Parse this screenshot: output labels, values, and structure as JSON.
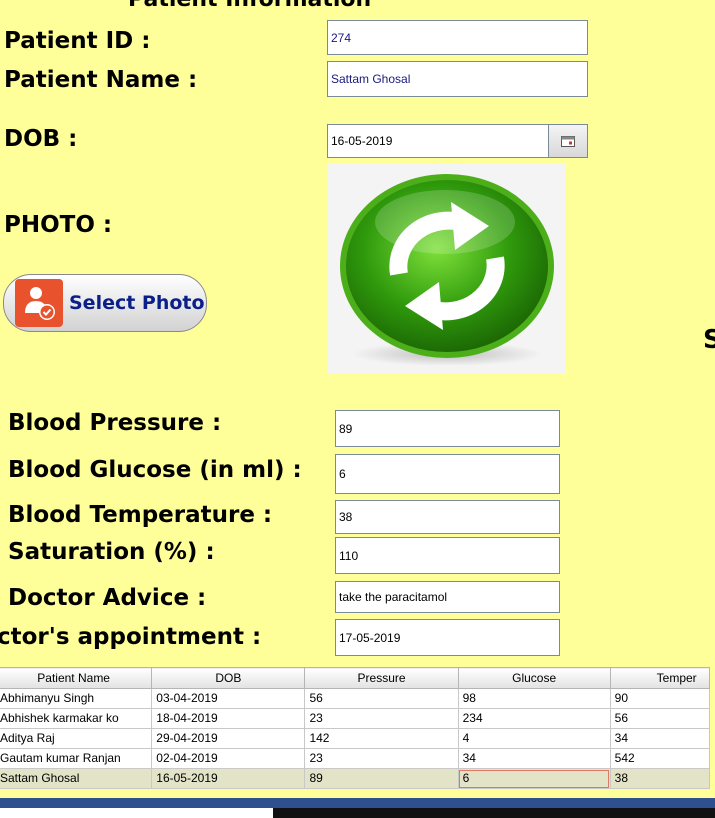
{
  "form": {
    "title": "Patient Information",
    "patient_id_label": "Patient ID :",
    "patient_id": "274",
    "patient_name_label": "Patient Name :",
    "patient_name": "Sattam Ghosal",
    "dob_label": "DOB :",
    "dob": "16-05-2019",
    "photo_label": "PHOTO :",
    "select_photo": "Select Photo",
    "side_letter": "S",
    "bp_label": "Blood Pressure :",
    "bp": "89",
    "glucose_label": "Blood Glucose (in ml) :",
    "glucose": "6",
    "temp_label": "Blood Temperature :",
    "temp": "38",
    "sat_label": "Saturation (%) :",
    "sat": "110",
    "advice_label": "Doctor Advice :",
    "advice": "take the paracitamol",
    "appt_label": "ctor's appointment :",
    "appt": "17-05-2019"
  },
  "table": {
    "headers": [
      "Patient Name",
      "DOB",
      "Pressure",
      "Glucose",
      "Temper"
    ],
    "rows": [
      [
        "Abhimanyu Singh",
        "03-04-2019",
        "56",
        "98",
        "90"
      ],
      [
        "Abhishek karmakar ko",
        "18-04-2019",
        "23",
        "234",
        "56"
      ],
      [
        "Aditya Raj",
        "29-04-2019",
        "142",
        "4",
        "34"
      ],
      [
        "Gautam kumar  Ranjan",
        "02-04-2019",
        "23",
        "34",
        "542"
      ],
      [
        "Sattam Ghosal",
        "16-05-2019",
        "89",
        "6",
        "38"
      ]
    ],
    "selected_row": 4
  },
  "colors": {
    "background": "#ffff99",
    "button_text": "#0b1f8a",
    "icon_orange": "#e8532e",
    "refresh_green": "#3a9a10"
  }
}
